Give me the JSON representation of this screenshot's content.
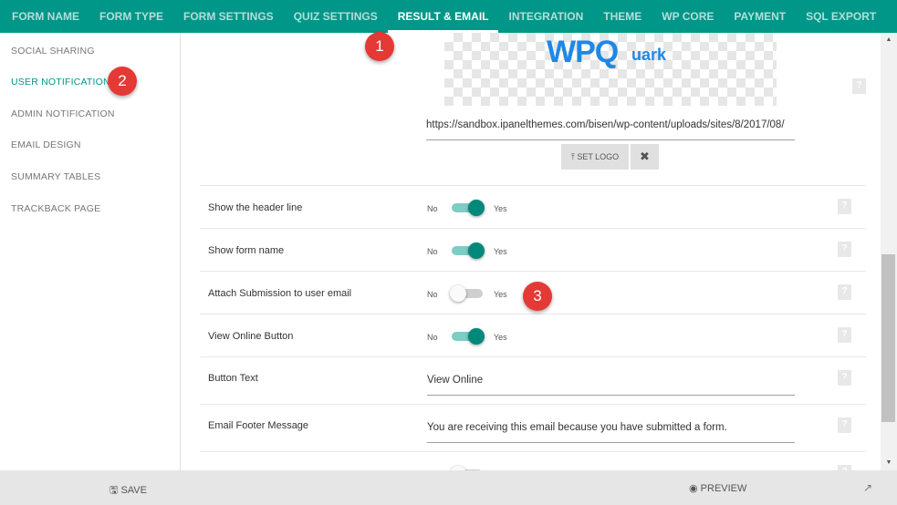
{
  "topnav": {
    "tabs": [
      {
        "label": "FORM NAME"
      },
      {
        "label": "FORM TYPE"
      },
      {
        "label": "FORM SETTINGS"
      },
      {
        "label": "QUIZ SETTINGS"
      },
      {
        "label": "RESULT & EMAIL"
      },
      {
        "label": "INTEGRATION"
      },
      {
        "label": "THEME"
      },
      {
        "label": "WP CORE"
      },
      {
        "label": "PAYMENT"
      },
      {
        "label": "SQL EXPORT"
      }
    ],
    "active_tab": "RESULT & EMAIL"
  },
  "sidebar": {
    "items": [
      {
        "label": "SOCIAL SHARING"
      },
      {
        "label": "USER NOTIFICATION"
      },
      {
        "label": "ADMIN NOTIFICATION"
      },
      {
        "label": "EMAIL DESIGN"
      },
      {
        "label": "SUMMARY TABLES"
      },
      {
        "label": "TRACKBACK PAGE"
      }
    ],
    "active_item": "USER NOTIFICATION"
  },
  "logo": {
    "text": "WPQ",
    "sub": "uark",
    "url": "https://sandbox.ipanelthemes.com/bisen/wp-content/uploads/sites/8/2017/08/",
    "set_logo_label": "SET LOGO",
    "set_logo_icon": "upload-icon",
    "remove_icon": "close-icon"
  },
  "settings": {
    "no_label": "No",
    "yes_label": "Yes",
    "rows": [
      {
        "label": "Show the header line",
        "type": "toggle",
        "on": true
      },
      {
        "label": "Show form name",
        "type": "toggle",
        "on": true
      },
      {
        "label": "Attach Submission to user email",
        "type": "toggle",
        "on": false
      },
      {
        "label": "View Online Button",
        "type": "toggle",
        "on": true
      },
      {
        "label": "Button Text",
        "type": "text",
        "value": "View Online"
      },
      {
        "label": "Email Footer Message",
        "type": "text",
        "value": "You are receiving this email because you have submitted a form."
      }
    ],
    "help_icon": "help-icon"
  },
  "footer": {
    "save_label": "SAVE",
    "save_icon": "floppy-disk-icon",
    "preview_label": "PREVIEW",
    "preview_icon": "eye-icon",
    "external_icon": "external-link-icon"
  },
  "annotations": {
    "step1": "1",
    "step2": "2",
    "step3": "3"
  },
  "colors": {
    "primary": "#009688",
    "toggle_on": "#00897b",
    "badge": "#e53935"
  }
}
